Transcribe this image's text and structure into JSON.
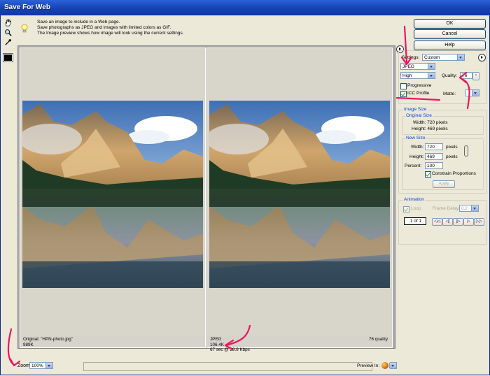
{
  "window": {
    "title": "Save For Web"
  },
  "tools": [
    {
      "name": "hand-tool-icon"
    },
    {
      "name": "zoom-tool-icon"
    },
    {
      "name": "eyedropper-tool-icon"
    }
  ],
  "hint": {
    "line1": "Save an image to include in a Web page.",
    "line2": "Save photographs as JPEG and images with limited colors as GIF.",
    "line3": "The Image preview shows how image will look using the current settings."
  },
  "preview": {
    "original": {
      "line1": "Original: \"HPN-photo.jpg\"",
      "line2": "989K"
    },
    "optimized": {
      "line1": "JPEG",
      "line2": "106.4K",
      "line3": "67 sec @ 28.8 Kbps",
      "quality_label": "76 quality"
    }
  },
  "zoom": {
    "label": "Zoom:",
    "value": "100%"
  },
  "preview_in": {
    "label": "Preview In:"
  },
  "buttons": {
    "ok": "OK",
    "cancel": "Cancel",
    "help": "Help"
  },
  "settings": {
    "preset_label": "Settings:",
    "preset_value": "Custom",
    "format": "JPEG",
    "quality_preset": "High",
    "quality_label": "Quality:",
    "quality_value": "76",
    "progressive_label": "Progressive",
    "progressive_checked": false,
    "icc_label": "ICC Profile",
    "icc_checked": true,
    "matte_label": "Matte:"
  },
  "image_size": {
    "title": "Image Size",
    "original_title": "Original Size",
    "orig_width": "Width: 720 pixels",
    "orig_height": "Height: 469 pixels",
    "new_title": "New Size",
    "width_label": "Width:",
    "width_value": "720",
    "height_label": "Height:",
    "height_value": "469",
    "units": "pixels",
    "percent_label": "Percent:",
    "percent_value": "100",
    "constrain_label": "Constrain Proportions",
    "constrain_checked": true,
    "apply_label": "Apply"
  },
  "animation": {
    "title": "Animation",
    "loop_label": "Loop",
    "frame_delay_label": "Frame Delay:",
    "frame_delay_value": "0.2",
    "frame_counter": "1 of 1",
    "controls": [
      "first-frame",
      "previous-frame",
      "play",
      "next-frame",
      "last-frame"
    ]
  },
  "colors": {
    "accent": "#0046d5",
    "annotation": "#e8175d",
    "title_bar": "#1744b8"
  }
}
